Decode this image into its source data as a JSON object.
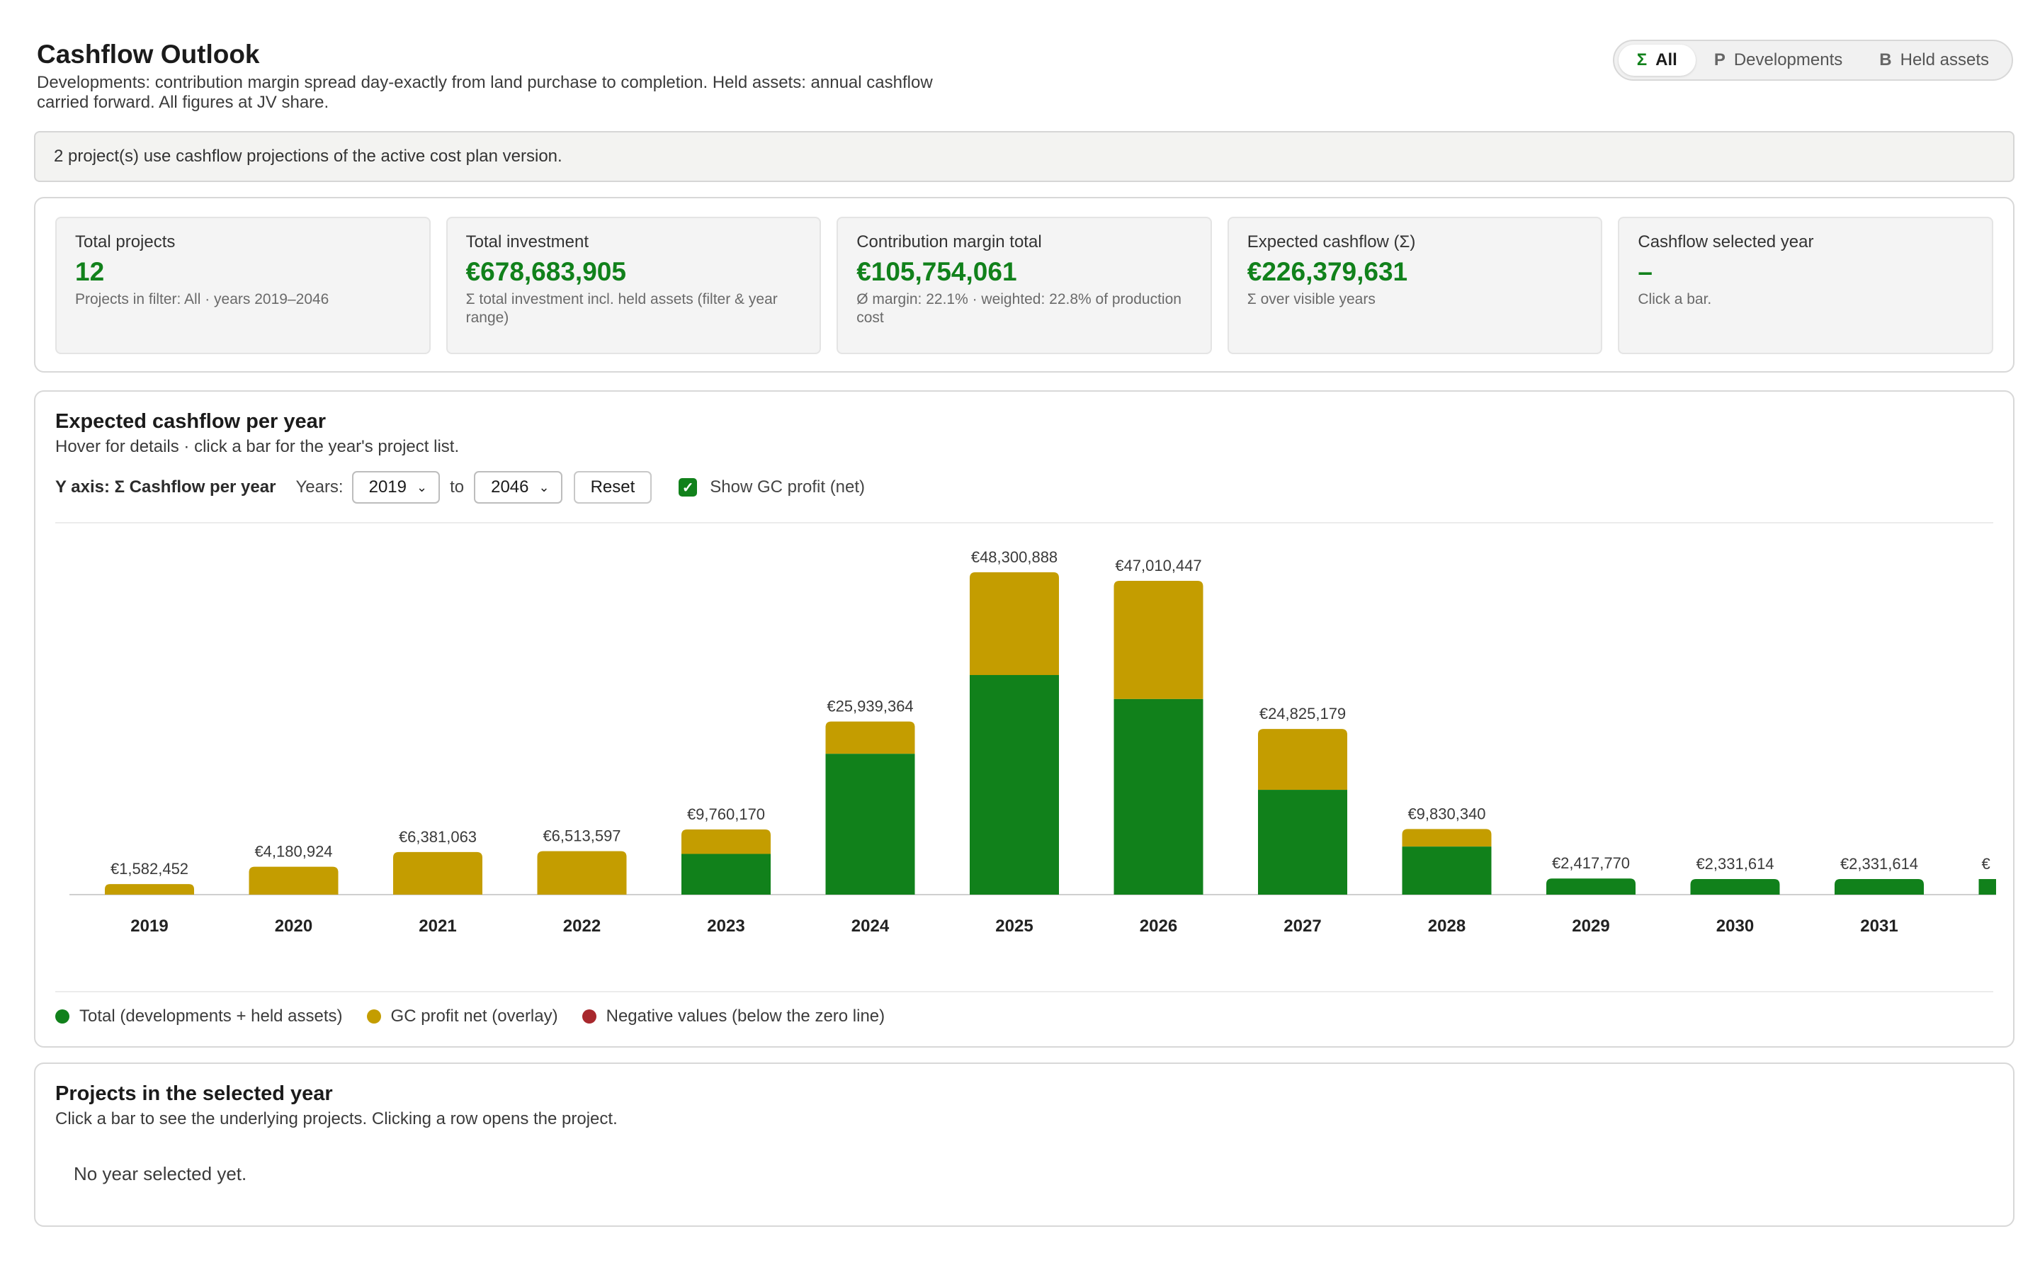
{
  "header": {
    "title": "Cashflow Outlook",
    "subtitle": "Developments: contribution margin spread day-exactly from land purchase to completion. Held assets: annual cashflow carried forward. All figures at JV share."
  },
  "scope": [
    {
      "glyph": "Σ",
      "label": "All",
      "active": true
    },
    {
      "glyph": "P",
      "label": "Developments",
      "active": false
    },
    {
      "glyph": "B",
      "label": "Held assets",
      "active": false
    }
  ],
  "notice": "2 project(s) use cashflow projections of the active cost plan version.",
  "kpis": [
    {
      "label": "Total projects",
      "value": "12",
      "note": "Projects in filter: All · years 2019–2046"
    },
    {
      "label": "Total investment",
      "value": "€678,683,905",
      "note": "Σ total investment incl. held assets (filter & year range)"
    },
    {
      "label": "Contribution margin total",
      "value": "€105,754,061",
      "note": "Ø margin: 22.1% · weighted: 22.8% of production cost"
    },
    {
      "label": "Expected cashflow (Σ)",
      "value": "€226,379,631",
      "note": "Σ over visible years"
    },
    {
      "label": "Cashflow selected year",
      "value": "–",
      "note": "Click a bar."
    }
  ],
  "chart_section": {
    "title": "Expected cashflow per year",
    "subtitle": "Hover for details · click a bar for the year's project list.",
    "y_axis_label": "Y axis: Σ Cashflow per year",
    "years_label": "Years:",
    "from_year": "2019",
    "to_label": "to",
    "to_year": "2046",
    "reset_label": "Reset",
    "show_gc_label": "Show GC profit (net)",
    "show_gc_checked": true
  },
  "legend": [
    {
      "label": "Total (developments + held assets)",
      "color": "#11811b"
    },
    {
      "label": "GC profit net (overlay)",
      "color": "#c49d00"
    },
    {
      "label": "Negative values (below the zero line)",
      "color": "#a8282d"
    }
  ],
  "chart_data": {
    "type": "bar",
    "stacked": true,
    "categories": [
      "2019",
      "2020",
      "2021",
      "2022",
      "2023",
      "2024",
      "2025",
      "2026",
      "2027",
      "2028",
      "2029",
      "2030",
      "2031"
    ],
    "series": [
      {
        "name": "Total (developments + held assets)",
        "color": "#11811b",
        "values": [
          0,
          0,
          0,
          0,
          6100000,
          21100000,
          32900000,
          29300000,
          15700000,
          7200000,
          2417770,
          2331614,
          2331614
        ]
      },
      {
        "name": "GC profit net (overlay)",
        "color": "#c49d00",
        "values": [
          1582452,
          4180924,
          6381063,
          6513597,
          3660170,
          4839364,
          15400888,
          17710447,
          9125179,
          2630340,
          0,
          0,
          0
        ]
      }
    ],
    "totals_labels": [
      "€1,582,452",
      "€4,180,924",
      "€6,381,063",
      "€6,513,597",
      "€9,760,170",
      "€25,939,364",
      "€48,300,888",
      "€47,010,447",
      "€24,825,179",
      "€9,830,340",
      "€2,417,770",
      "€2,331,614",
      "€2,331,614"
    ],
    "overflow_label": "€",
    "ylim": [
      0,
      52000000
    ],
    "grid": false
  },
  "projects_section": {
    "title": "Projects in the selected year",
    "subtitle": "Click a bar to see the underlying projects. Clicking a row opens the project.",
    "empty": "No year selected yet."
  }
}
